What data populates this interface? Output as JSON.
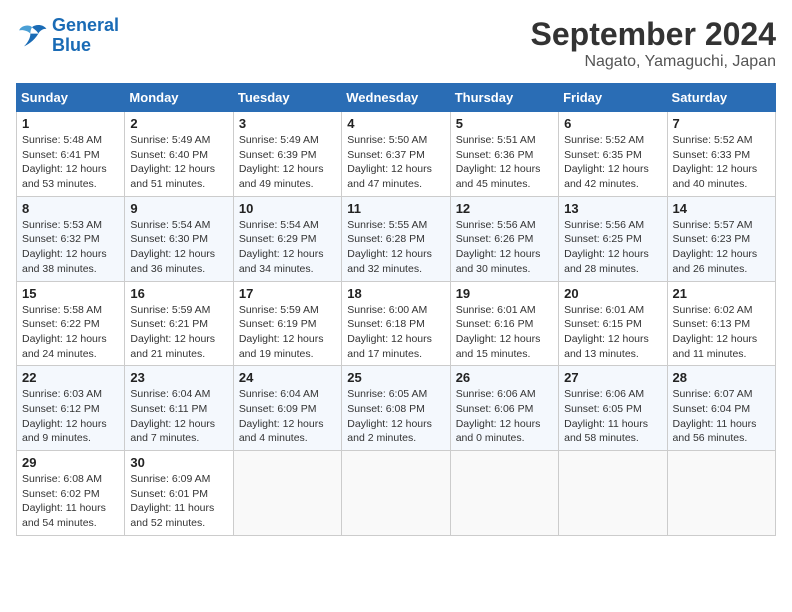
{
  "logo": {
    "line1": "General",
    "line2": "Blue"
  },
  "title": "September 2024",
  "location": "Nagato, Yamaguchi, Japan",
  "weekdays": [
    "Sunday",
    "Monday",
    "Tuesday",
    "Wednesday",
    "Thursday",
    "Friday",
    "Saturday"
  ],
  "weeks": [
    [
      {
        "day": "1",
        "info": "Sunrise: 5:48 AM\nSunset: 6:41 PM\nDaylight: 12 hours\nand 53 minutes."
      },
      {
        "day": "2",
        "info": "Sunrise: 5:49 AM\nSunset: 6:40 PM\nDaylight: 12 hours\nand 51 minutes."
      },
      {
        "day": "3",
        "info": "Sunrise: 5:49 AM\nSunset: 6:39 PM\nDaylight: 12 hours\nand 49 minutes."
      },
      {
        "day": "4",
        "info": "Sunrise: 5:50 AM\nSunset: 6:37 PM\nDaylight: 12 hours\nand 47 minutes."
      },
      {
        "day": "5",
        "info": "Sunrise: 5:51 AM\nSunset: 6:36 PM\nDaylight: 12 hours\nand 45 minutes."
      },
      {
        "day": "6",
        "info": "Sunrise: 5:52 AM\nSunset: 6:35 PM\nDaylight: 12 hours\nand 42 minutes."
      },
      {
        "day": "7",
        "info": "Sunrise: 5:52 AM\nSunset: 6:33 PM\nDaylight: 12 hours\nand 40 minutes."
      }
    ],
    [
      {
        "day": "8",
        "info": "Sunrise: 5:53 AM\nSunset: 6:32 PM\nDaylight: 12 hours\nand 38 minutes."
      },
      {
        "day": "9",
        "info": "Sunrise: 5:54 AM\nSunset: 6:30 PM\nDaylight: 12 hours\nand 36 minutes."
      },
      {
        "day": "10",
        "info": "Sunrise: 5:54 AM\nSunset: 6:29 PM\nDaylight: 12 hours\nand 34 minutes."
      },
      {
        "day": "11",
        "info": "Sunrise: 5:55 AM\nSunset: 6:28 PM\nDaylight: 12 hours\nand 32 minutes."
      },
      {
        "day": "12",
        "info": "Sunrise: 5:56 AM\nSunset: 6:26 PM\nDaylight: 12 hours\nand 30 minutes."
      },
      {
        "day": "13",
        "info": "Sunrise: 5:56 AM\nSunset: 6:25 PM\nDaylight: 12 hours\nand 28 minutes."
      },
      {
        "day": "14",
        "info": "Sunrise: 5:57 AM\nSunset: 6:23 PM\nDaylight: 12 hours\nand 26 minutes."
      }
    ],
    [
      {
        "day": "15",
        "info": "Sunrise: 5:58 AM\nSunset: 6:22 PM\nDaylight: 12 hours\nand 24 minutes."
      },
      {
        "day": "16",
        "info": "Sunrise: 5:59 AM\nSunset: 6:21 PM\nDaylight: 12 hours\nand 21 minutes."
      },
      {
        "day": "17",
        "info": "Sunrise: 5:59 AM\nSunset: 6:19 PM\nDaylight: 12 hours\nand 19 minutes."
      },
      {
        "day": "18",
        "info": "Sunrise: 6:00 AM\nSunset: 6:18 PM\nDaylight: 12 hours\nand 17 minutes."
      },
      {
        "day": "19",
        "info": "Sunrise: 6:01 AM\nSunset: 6:16 PM\nDaylight: 12 hours\nand 15 minutes."
      },
      {
        "day": "20",
        "info": "Sunrise: 6:01 AM\nSunset: 6:15 PM\nDaylight: 12 hours\nand 13 minutes."
      },
      {
        "day": "21",
        "info": "Sunrise: 6:02 AM\nSunset: 6:13 PM\nDaylight: 12 hours\nand 11 minutes."
      }
    ],
    [
      {
        "day": "22",
        "info": "Sunrise: 6:03 AM\nSunset: 6:12 PM\nDaylight: 12 hours\nand 9 minutes."
      },
      {
        "day": "23",
        "info": "Sunrise: 6:04 AM\nSunset: 6:11 PM\nDaylight: 12 hours\nand 7 minutes."
      },
      {
        "day": "24",
        "info": "Sunrise: 6:04 AM\nSunset: 6:09 PM\nDaylight: 12 hours\nand 4 minutes."
      },
      {
        "day": "25",
        "info": "Sunrise: 6:05 AM\nSunset: 6:08 PM\nDaylight: 12 hours\nand 2 minutes."
      },
      {
        "day": "26",
        "info": "Sunrise: 6:06 AM\nSunset: 6:06 PM\nDaylight: 12 hours\nand 0 minutes."
      },
      {
        "day": "27",
        "info": "Sunrise: 6:06 AM\nSunset: 6:05 PM\nDaylight: 11 hours\nand 58 minutes."
      },
      {
        "day": "28",
        "info": "Sunrise: 6:07 AM\nSunset: 6:04 PM\nDaylight: 11 hours\nand 56 minutes."
      }
    ],
    [
      {
        "day": "29",
        "info": "Sunrise: 6:08 AM\nSunset: 6:02 PM\nDaylight: 11 hours\nand 54 minutes."
      },
      {
        "day": "30",
        "info": "Sunrise: 6:09 AM\nSunset: 6:01 PM\nDaylight: 11 hours\nand 52 minutes."
      },
      {
        "day": "",
        "info": ""
      },
      {
        "day": "",
        "info": ""
      },
      {
        "day": "",
        "info": ""
      },
      {
        "day": "",
        "info": ""
      },
      {
        "day": "",
        "info": ""
      }
    ]
  ]
}
